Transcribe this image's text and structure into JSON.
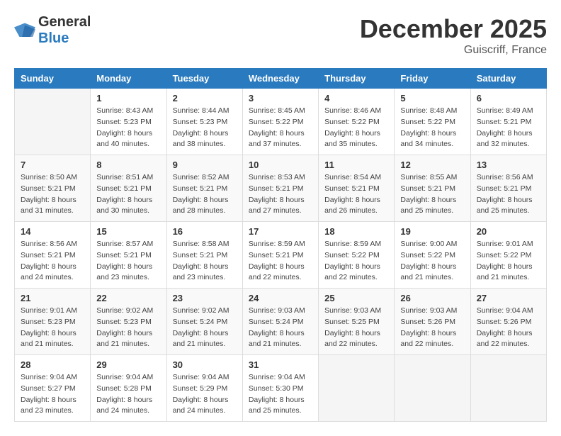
{
  "header": {
    "logo_general": "General",
    "logo_blue": "Blue",
    "title": "December 2025",
    "location": "Guiscriff, France"
  },
  "days_of_week": [
    "Sunday",
    "Monday",
    "Tuesday",
    "Wednesday",
    "Thursday",
    "Friday",
    "Saturday"
  ],
  "weeks": [
    [
      {
        "day": "",
        "sunrise": "",
        "sunset": "",
        "daylight": ""
      },
      {
        "day": "1",
        "sunrise": "Sunrise: 8:43 AM",
        "sunset": "Sunset: 5:23 PM",
        "daylight": "Daylight: 8 hours and 40 minutes."
      },
      {
        "day": "2",
        "sunrise": "Sunrise: 8:44 AM",
        "sunset": "Sunset: 5:23 PM",
        "daylight": "Daylight: 8 hours and 38 minutes."
      },
      {
        "day": "3",
        "sunrise": "Sunrise: 8:45 AM",
        "sunset": "Sunset: 5:22 PM",
        "daylight": "Daylight: 8 hours and 37 minutes."
      },
      {
        "day": "4",
        "sunrise": "Sunrise: 8:46 AM",
        "sunset": "Sunset: 5:22 PM",
        "daylight": "Daylight: 8 hours and 35 minutes."
      },
      {
        "day": "5",
        "sunrise": "Sunrise: 8:48 AM",
        "sunset": "Sunset: 5:22 PM",
        "daylight": "Daylight: 8 hours and 34 minutes."
      },
      {
        "day": "6",
        "sunrise": "Sunrise: 8:49 AM",
        "sunset": "Sunset: 5:21 PM",
        "daylight": "Daylight: 8 hours and 32 minutes."
      }
    ],
    [
      {
        "day": "7",
        "sunrise": "Sunrise: 8:50 AM",
        "sunset": "Sunset: 5:21 PM",
        "daylight": "Daylight: 8 hours and 31 minutes."
      },
      {
        "day": "8",
        "sunrise": "Sunrise: 8:51 AM",
        "sunset": "Sunset: 5:21 PM",
        "daylight": "Daylight: 8 hours and 30 minutes."
      },
      {
        "day": "9",
        "sunrise": "Sunrise: 8:52 AM",
        "sunset": "Sunset: 5:21 PM",
        "daylight": "Daylight: 8 hours and 28 minutes."
      },
      {
        "day": "10",
        "sunrise": "Sunrise: 8:53 AM",
        "sunset": "Sunset: 5:21 PM",
        "daylight": "Daylight: 8 hours and 27 minutes."
      },
      {
        "day": "11",
        "sunrise": "Sunrise: 8:54 AM",
        "sunset": "Sunset: 5:21 PM",
        "daylight": "Daylight: 8 hours and 26 minutes."
      },
      {
        "day": "12",
        "sunrise": "Sunrise: 8:55 AM",
        "sunset": "Sunset: 5:21 PM",
        "daylight": "Daylight: 8 hours and 25 minutes."
      },
      {
        "day": "13",
        "sunrise": "Sunrise: 8:56 AM",
        "sunset": "Sunset: 5:21 PM",
        "daylight": "Daylight: 8 hours and 25 minutes."
      }
    ],
    [
      {
        "day": "14",
        "sunrise": "Sunrise: 8:56 AM",
        "sunset": "Sunset: 5:21 PM",
        "daylight": "Daylight: 8 hours and 24 minutes."
      },
      {
        "day": "15",
        "sunrise": "Sunrise: 8:57 AM",
        "sunset": "Sunset: 5:21 PM",
        "daylight": "Daylight: 8 hours and 23 minutes."
      },
      {
        "day": "16",
        "sunrise": "Sunrise: 8:58 AM",
        "sunset": "Sunset: 5:21 PM",
        "daylight": "Daylight: 8 hours and 23 minutes."
      },
      {
        "day": "17",
        "sunrise": "Sunrise: 8:59 AM",
        "sunset": "Sunset: 5:21 PM",
        "daylight": "Daylight: 8 hours and 22 minutes."
      },
      {
        "day": "18",
        "sunrise": "Sunrise: 8:59 AM",
        "sunset": "Sunset: 5:22 PM",
        "daylight": "Daylight: 8 hours and 22 minutes."
      },
      {
        "day": "19",
        "sunrise": "Sunrise: 9:00 AM",
        "sunset": "Sunset: 5:22 PM",
        "daylight": "Daylight: 8 hours and 21 minutes."
      },
      {
        "day": "20",
        "sunrise": "Sunrise: 9:01 AM",
        "sunset": "Sunset: 5:22 PM",
        "daylight": "Daylight: 8 hours and 21 minutes."
      }
    ],
    [
      {
        "day": "21",
        "sunrise": "Sunrise: 9:01 AM",
        "sunset": "Sunset: 5:23 PM",
        "daylight": "Daylight: 8 hours and 21 minutes."
      },
      {
        "day": "22",
        "sunrise": "Sunrise: 9:02 AM",
        "sunset": "Sunset: 5:23 PM",
        "daylight": "Daylight: 8 hours and 21 minutes."
      },
      {
        "day": "23",
        "sunrise": "Sunrise: 9:02 AM",
        "sunset": "Sunset: 5:24 PM",
        "daylight": "Daylight: 8 hours and 21 minutes."
      },
      {
        "day": "24",
        "sunrise": "Sunrise: 9:03 AM",
        "sunset": "Sunset: 5:24 PM",
        "daylight": "Daylight: 8 hours and 21 minutes."
      },
      {
        "day": "25",
        "sunrise": "Sunrise: 9:03 AM",
        "sunset": "Sunset: 5:25 PM",
        "daylight": "Daylight: 8 hours and 22 minutes."
      },
      {
        "day": "26",
        "sunrise": "Sunrise: 9:03 AM",
        "sunset": "Sunset: 5:26 PM",
        "daylight": "Daylight: 8 hours and 22 minutes."
      },
      {
        "day": "27",
        "sunrise": "Sunrise: 9:04 AM",
        "sunset": "Sunset: 5:26 PM",
        "daylight": "Daylight: 8 hours and 22 minutes."
      }
    ],
    [
      {
        "day": "28",
        "sunrise": "Sunrise: 9:04 AM",
        "sunset": "Sunset: 5:27 PM",
        "daylight": "Daylight: 8 hours and 23 minutes."
      },
      {
        "day": "29",
        "sunrise": "Sunrise: 9:04 AM",
        "sunset": "Sunset: 5:28 PM",
        "daylight": "Daylight: 8 hours and 24 minutes."
      },
      {
        "day": "30",
        "sunrise": "Sunrise: 9:04 AM",
        "sunset": "Sunset: 5:29 PM",
        "daylight": "Daylight: 8 hours and 24 minutes."
      },
      {
        "day": "31",
        "sunrise": "Sunrise: 9:04 AM",
        "sunset": "Sunset: 5:30 PM",
        "daylight": "Daylight: 8 hours and 25 minutes."
      },
      {
        "day": "",
        "sunrise": "",
        "sunset": "",
        "daylight": ""
      },
      {
        "day": "",
        "sunrise": "",
        "sunset": "",
        "daylight": ""
      },
      {
        "day": "",
        "sunrise": "",
        "sunset": "",
        "daylight": ""
      }
    ]
  ]
}
